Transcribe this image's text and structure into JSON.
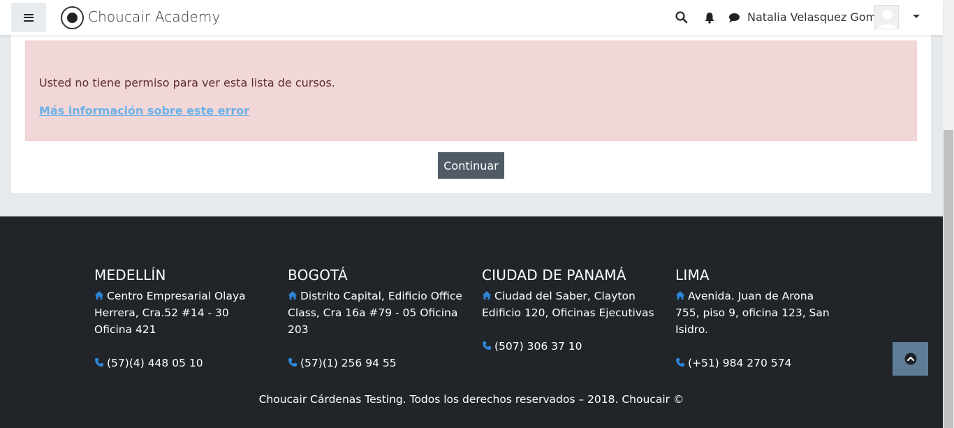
{
  "header": {
    "brand": "Choucair Academy",
    "user_name": "Natalia Velasquez Gomez"
  },
  "alert": {
    "message": "Usted no tiene permiso para ver esta lista de cursos.",
    "link": "Más información sobre este error"
  },
  "continue_label": "Continuar",
  "footer": {
    "offices": [
      {
        "city": "MEDELLÍN",
        "address": "Centro Empresarial Olaya Herrera, Cra.52 #14 - 30 Oficina 421",
        "phone": "(57)(4) 448 05 10"
      },
      {
        "city": "BOGOTÁ",
        "address": "Distrito Capital, Edificio Office Class, Cra 16a #79 - 05 Oficina 203",
        "phone": "(57)(1) 256 94 55"
      },
      {
        "city": "CIUDAD DE PANAMÁ",
        "address": "Ciudad del Saber, Clayton Edificio 120, Oficinas Ejecutivas",
        "phone": "(507) 306 37 10"
      },
      {
        "city": "LIMA",
        "address": "Avenida. Juan de Arona 755, piso 9, oficina 123, San Isidro.",
        "phone": "(+51) 984 270 574"
      }
    ],
    "copyright": "Choucair Cárdenas Testing. Todos los derechos reservados – 2018. Choucair ©"
  },
  "colors": {
    "alert_bg": "#f2d7d9",
    "footer_bg": "#212529",
    "icon_blue": "#2d86d9",
    "button_bg": "#505b66"
  },
  "icons": [
    "menu-icon",
    "search-icon",
    "bell-icon",
    "chat-icon",
    "home-icon",
    "phone-icon",
    "chevron-up-icon"
  ]
}
